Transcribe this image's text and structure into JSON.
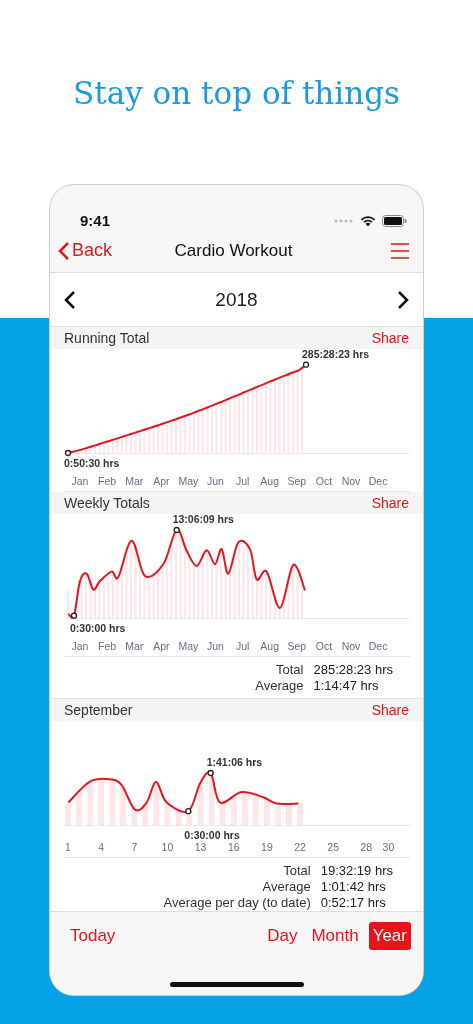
{
  "headline": "Stay on top of things",
  "status_bar": {
    "time": "9:41"
  },
  "nav": {
    "back": "Back",
    "title": "Cardio Workout"
  },
  "year_selector": {
    "value": "2018"
  },
  "sections": [
    {
      "title": "Running Total",
      "action": "Share",
      "kind": "cumulative",
      "x_labels": [
        "Jan",
        "Feb",
        "Mar",
        "Apr",
        "May",
        "Jun",
        "Jul",
        "Aug",
        "Sep",
        "Oct",
        "Nov",
        "Dec"
      ],
      "annotations": [
        {
          "label": "285:28:23 hrs",
          "kind": "max"
        },
        {
          "label": "0:50:30 hrs",
          "kind": "min"
        }
      ]
    },
    {
      "title": "Weekly Totals",
      "action": "Share",
      "kind": "weekly",
      "x_labels": [
        "Jan",
        "Feb",
        "Mar",
        "Apr",
        "May",
        "Jun",
        "Jul",
        "Aug",
        "Sep",
        "Oct",
        "Nov",
        "Dec"
      ],
      "annotations": [
        {
          "label": "13:06:09 hrs",
          "kind": "max"
        },
        {
          "label": "0:30:00 hrs",
          "kind": "min"
        }
      ],
      "stats": [
        {
          "label": "Total",
          "value": "285:28:23 hrs"
        },
        {
          "label": "Average",
          "value": "1:14:47 hrs"
        }
      ]
    },
    {
      "title": "September",
      "action": "Share",
      "kind": "daily",
      "x_labels": [
        "1",
        "4",
        "7",
        "10",
        "13",
        "16",
        "19",
        "22",
        "25",
        "28",
        "30"
      ],
      "annotations": [
        {
          "label": "1:41:06 hrs",
          "kind": "max"
        },
        {
          "label": "0:30:00 hrs",
          "kind": "min"
        }
      ],
      "stats": [
        {
          "label": "Total",
          "value": "19:32:19 hrs"
        },
        {
          "label": "Average",
          "value": "1:01:42 hrs"
        },
        {
          "label": "Average per day (to date)",
          "value": "0:52:17 hrs"
        }
      ]
    }
  ],
  "tab_bar": {
    "today": "Today",
    "periods": [
      {
        "label": "Day",
        "selected": false
      },
      {
        "label": "Month",
        "selected": false
      },
      {
        "label": "Year",
        "selected": true
      }
    ]
  }
}
